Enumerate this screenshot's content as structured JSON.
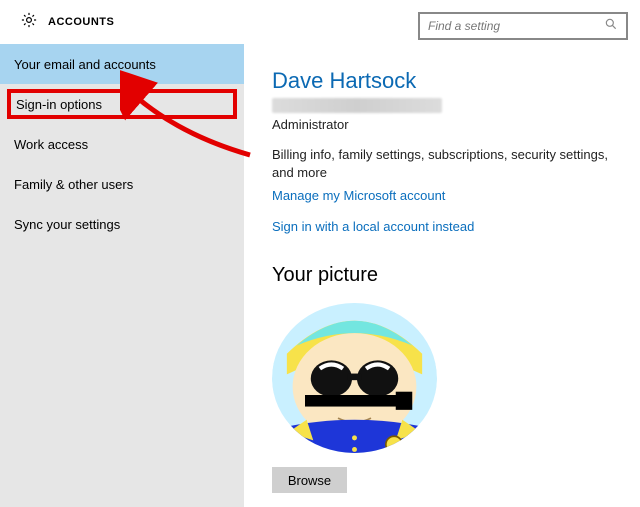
{
  "header": {
    "title": "ACCOUNTS",
    "search_placeholder": "Find a setting"
  },
  "sidebar": {
    "items": [
      {
        "label": "Your email and accounts",
        "selected": true
      },
      {
        "label": "Sign-in options",
        "highlighted": true
      },
      {
        "label": "Work access"
      },
      {
        "label": "Family & other users"
      },
      {
        "label": "Sync your settings"
      }
    ]
  },
  "main": {
    "user_name": "Dave Hartsock",
    "role": "Administrator",
    "desc": "Billing info, family settings, subscriptions, security settings, and more",
    "manage_link": "Manage my Microsoft account",
    "local_link": "Sign in with a local account instead",
    "picture_heading": "Your picture",
    "browse_label": "Browse"
  }
}
